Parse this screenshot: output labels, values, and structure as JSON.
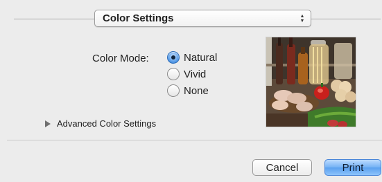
{
  "section_popup": {
    "selected": "Color Settings"
  },
  "color_mode": {
    "label": "Color Mode:",
    "options": [
      {
        "label": "Natural",
        "selected": true
      },
      {
        "label": "Vivid",
        "selected": false
      },
      {
        "label": "None",
        "selected": false
      }
    ]
  },
  "advanced": {
    "label": "Advanced Color Settings",
    "expanded": false
  },
  "buttons": {
    "cancel": "Cancel",
    "print": "Print"
  },
  "colors": {
    "accent": "#5aa0ef",
    "background": "#ececec"
  }
}
